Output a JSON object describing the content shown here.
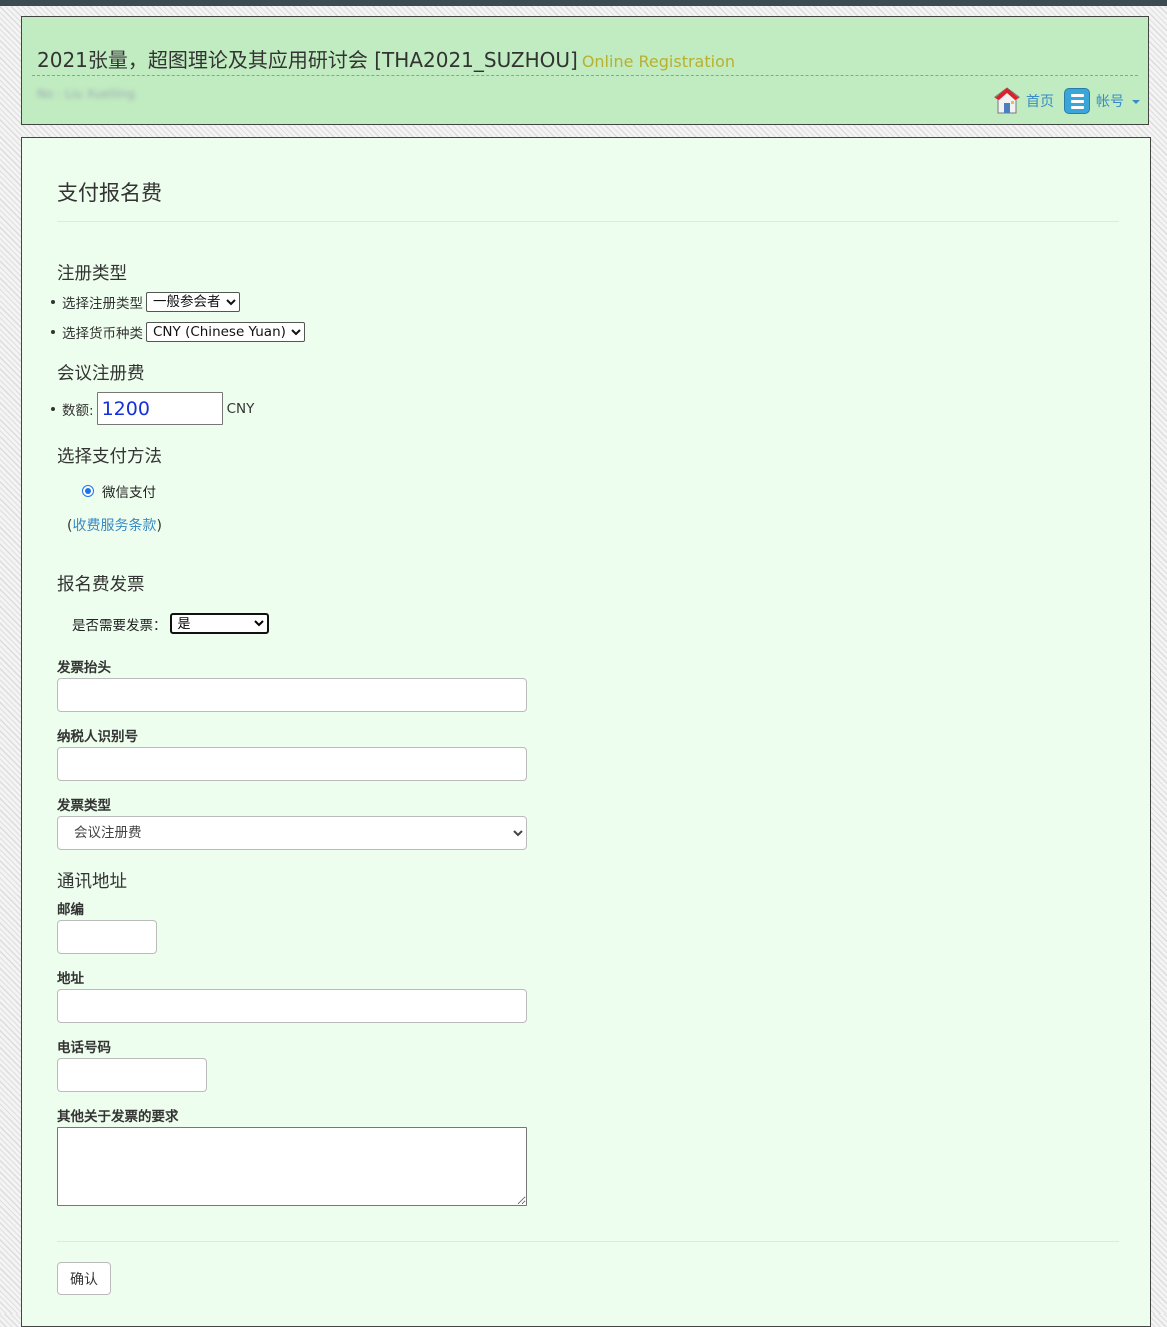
{
  "header": {
    "title": "2021张量，超图理论及其应用研讨会 [THA2021_SUZHOU]",
    "subtitle": "Online Registration",
    "user": "No :  Liu Xueliing",
    "nav": {
      "home": "首页",
      "account": "帐号"
    },
    "icons": {
      "home": "home-icon",
      "menu": "menu-icon",
      "caret": "caret-down-icon"
    }
  },
  "page": {
    "title": "支付报名费"
  },
  "registration": {
    "heading": "注册类型",
    "type_label": "选择注册类型",
    "type_value": "一般参会者",
    "currency_label": "选择货币种类",
    "currency_value": "CNY (Chinese Yuan)"
  },
  "fee": {
    "heading": "会议注册费",
    "amount_label": "数额:",
    "amount_value": "1200",
    "unit": "CNY"
  },
  "payment": {
    "heading": "选择支付方法",
    "method": "微信支付",
    "terms_prefix": "(",
    "terms_link": "收费服务条款",
    "terms_suffix": ")"
  },
  "invoice": {
    "heading": "报名费发票",
    "need_label": "是否需要发票：",
    "need_value": "是",
    "title_label": "发票抬头",
    "tax_label": "纳税人识别号",
    "type_label": "发票类型",
    "type_value": "会议注册费"
  },
  "address": {
    "heading": "通讯地址",
    "postcode_label": "邮编",
    "address_label": "地址",
    "phone_label": "电话号码",
    "other_label": "其他关于发票的要求"
  },
  "actions": {
    "confirm": "确认"
  },
  "colors": {
    "header_bg": "#c1ecc1",
    "panel_bg": "#eefeee",
    "link": "#3a8ac4",
    "subtitle": "#b8b030",
    "amount": "#1430d8"
  }
}
